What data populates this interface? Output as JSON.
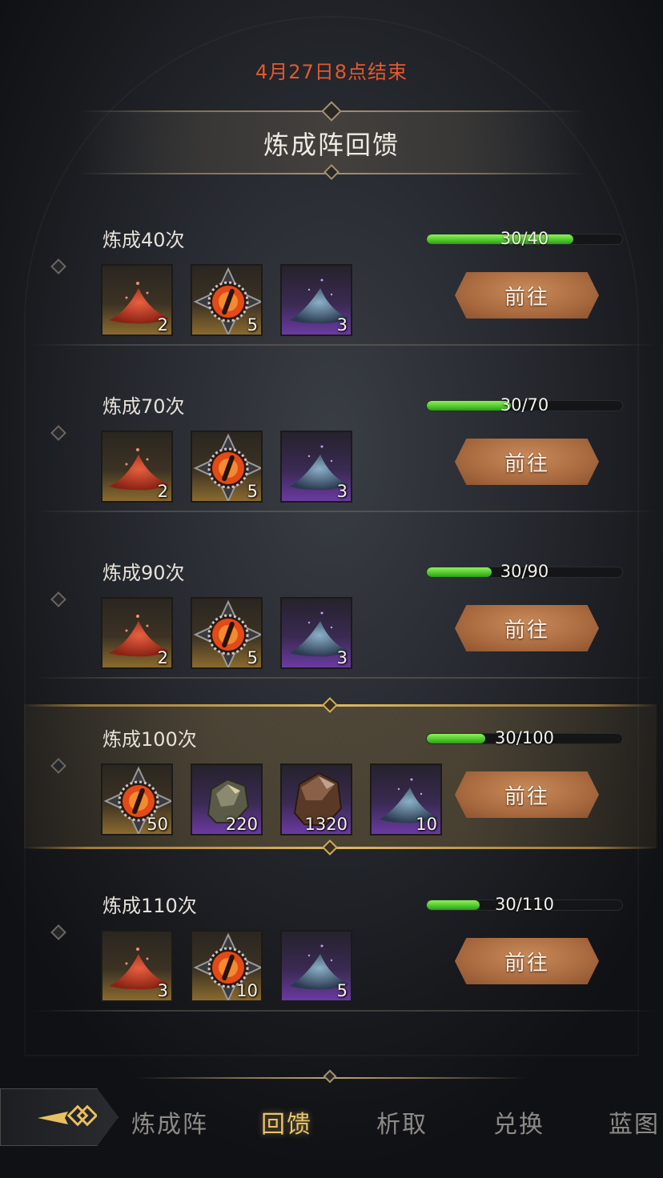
{
  "event": {
    "end_time": "4月27日8点结束",
    "title": "炼成阵回馈"
  },
  "rewards": [
    {
      "label": "炼成40次",
      "progress_text": "30/40",
      "progress": 0.75,
      "button": "前往",
      "items": [
        {
          "icon": "red-powder-icon",
          "rarity": "gold",
          "count": "2"
        },
        {
          "icon": "fire-eye-icon",
          "rarity": "gold",
          "count": "5"
        },
        {
          "icon": "blue-powder-icon",
          "rarity": "purple",
          "count": "3"
        }
      ]
    },
    {
      "label": "炼成70次",
      "progress_text": "30/70",
      "progress": 0.43,
      "button": "前往",
      "items": [
        {
          "icon": "red-powder-icon",
          "rarity": "gold",
          "count": "2"
        },
        {
          "icon": "fire-eye-icon",
          "rarity": "gold",
          "count": "5"
        },
        {
          "icon": "blue-powder-icon",
          "rarity": "purple",
          "count": "3"
        }
      ]
    },
    {
      "label": "炼成90次",
      "progress_text": "30/90",
      "progress": 0.33,
      "button": "前往",
      "items": [
        {
          "icon": "red-powder-icon",
          "rarity": "gold",
          "count": "2"
        },
        {
          "icon": "fire-eye-icon",
          "rarity": "gold",
          "count": "5"
        },
        {
          "icon": "blue-powder-icon",
          "rarity": "purple",
          "count": "3"
        }
      ]
    },
    {
      "label": "炼成100次",
      "progress_text": "30/100",
      "progress": 0.3,
      "button": "前往",
      "highlight": true,
      "items": [
        {
          "icon": "fire-eye-icon",
          "rarity": "gold",
          "count": "50"
        },
        {
          "icon": "dark-ore-icon",
          "rarity": "purple",
          "count": "220"
        },
        {
          "icon": "bronze-ore-icon",
          "rarity": "purple",
          "count": "1320"
        },
        {
          "icon": "blue-powder-icon",
          "rarity": "purple",
          "count": "10"
        }
      ]
    },
    {
      "label": "炼成110次",
      "progress_text": "30/110",
      "progress": 0.27,
      "button": "前往",
      "items": [
        {
          "icon": "red-powder-icon",
          "rarity": "gold",
          "count": "3"
        },
        {
          "icon": "fire-eye-icon",
          "rarity": "gold",
          "count": "10"
        },
        {
          "icon": "blue-powder-icon",
          "rarity": "purple",
          "count": "5"
        }
      ]
    }
  ],
  "tabs": [
    {
      "label": "炼成阵",
      "active": false
    },
    {
      "label": "回馈",
      "active": true
    },
    {
      "label": "析取",
      "active": false
    },
    {
      "label": "兑换",
      "active": false
    },
    {
      "label": "蓝图",
      "active": false
    }
  ],
  "colors": {
    "end_time": "#e5582f",
    "active_tab": "#e9c46a",
    "progress_fill": "#4dc62a",
    "button": "#b0703f"
  }
}
